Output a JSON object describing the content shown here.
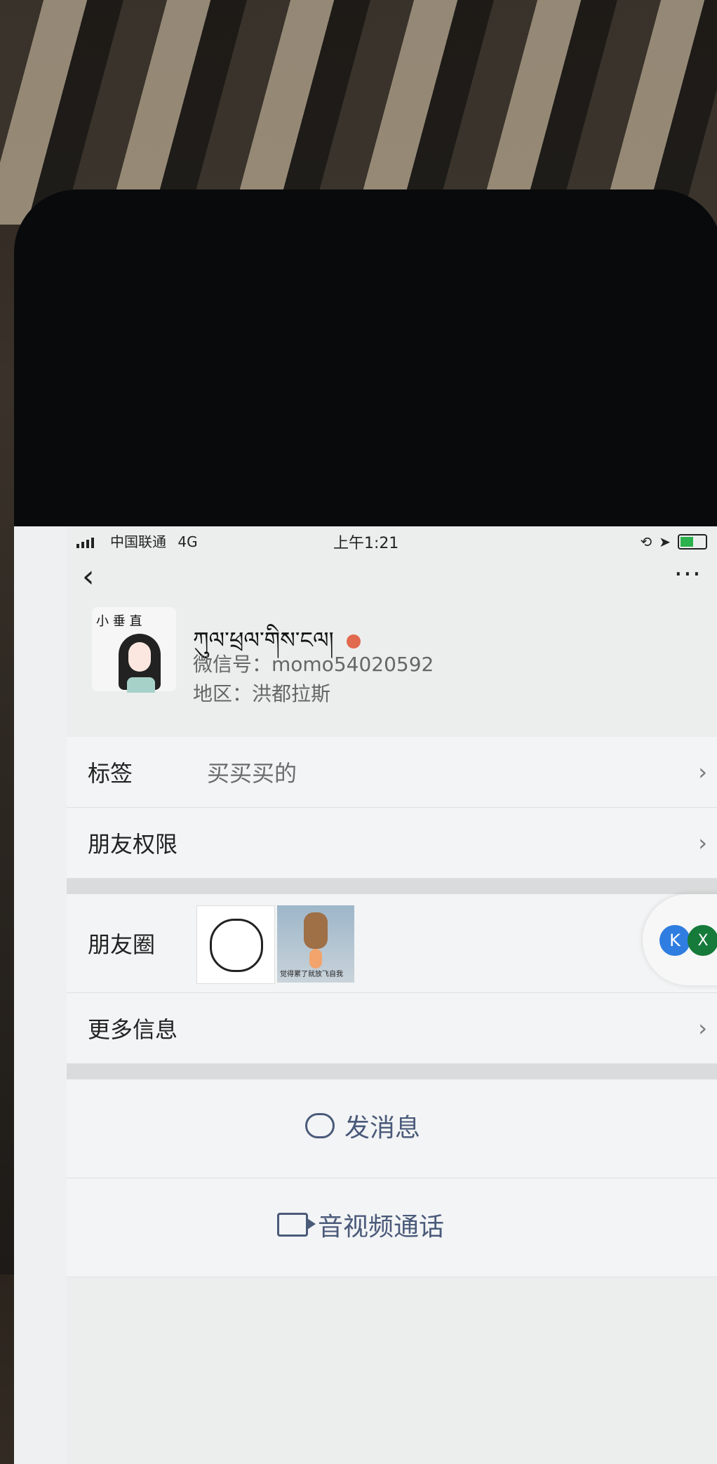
{
  "status": {
    "carrier": "中国联通",
    "network": "4G",
    "time": "上午1:21"
  },
  "profile": {
    "name": "ཀུལ་ཕྲལ་གིས་ངལ།",
    "wechat_id": "微信号：momo54020592",
    "region": "地区：洪都拉斯",
    "avatar_text": "小 垂 直"
  },
  "rows": {
    "tags": {
      "label": "标签",
      "value": "买买买的"
    },
    "friend_permission": {
      "label": "朋友权限"
    },
    "moments": {
      "label": "朋友圈",
      "img2_caption": "觉得累了就放飞自我"
    },
    "more_info": {
      "label": "更多信息"
    }
  },
  "actions": {
    "send_message": "发消息",
    "av_call": "音视频通话"
  },
  "floating": {
    "k": "K",
    "x": "X"
  },
  "colors": {
    "accent": "#4a5a7a",
    "gender": "#e0694e"
  }
}
